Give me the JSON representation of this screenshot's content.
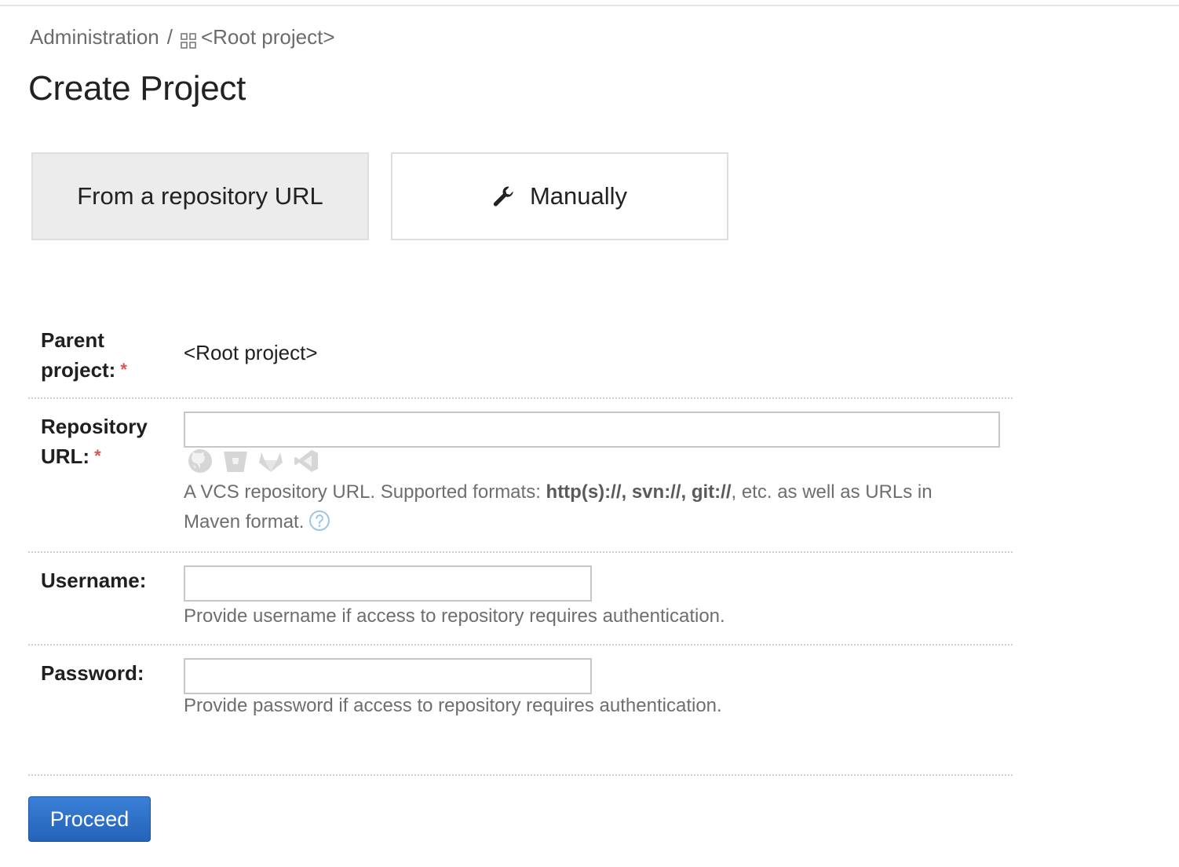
{
  "breadcrumb": {
    "admin": "Administration",
    "separator": "/",
    "project": "<Root project>"
  },
  "page": {
    "title": "Create Project"
  },
  "modes": {
    "repo_label": "From a repository URL",
    "manual_label": "Manually",
    "selected": "From a repository URL"
  },
  "form": {
    "parent_label_line1": "Parent",
    "parent_label_line2": "project:",
    "parent_value": "<Root project>",
    "repo_label_line1": "Repository",
    "repo_label_line2": "URL:",
    "repo_value": "",
    "repo_help_prefix": "A VCS repository URL. Supported formats: ",
    "repo_help_formats": "http(s)://, svn://, git://",
    "repo_help_suffix": ", etc. as well as URLs in",
    "repo_help_line2": "Maven format.",
    "required_marker": "*",
    "username_label": "Username:",
    "username_value": "",
    "username_help": "Provide username if access to repository requires authentication.",
    "password_label": "Password:",
    "password_value": "",
    "password_help": "Provide password if access to repository requires authentication."
  },
  "vcs_icons": [
    "github-icon",
    "bitbucket-icon",
    "gitlab-icon",
    "azure-devops-icon"
  ],
  "actions": {
    "proceed_label": "Proceed"
  },
  "colors": {
    "primary_button": "#2a6cc4",
    "required": "#d9534f",
    "active_tile": "#ececec"
  }
}
